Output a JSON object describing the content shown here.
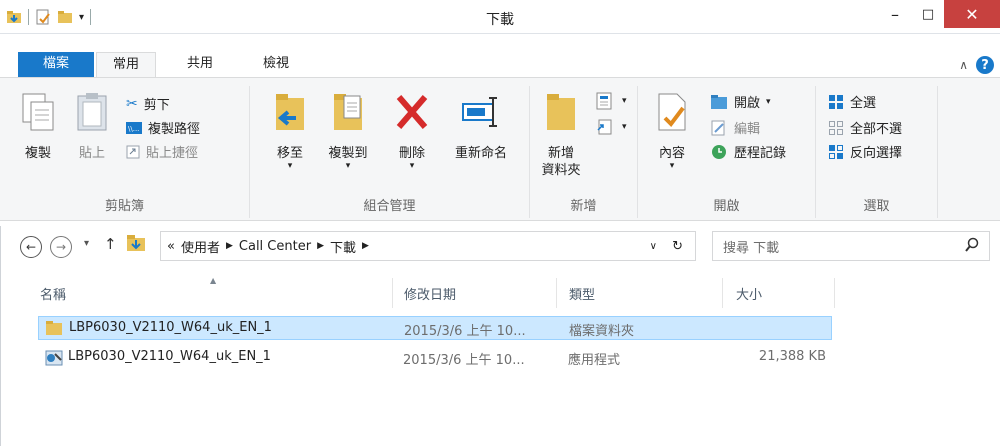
{
  "window": {
    "title": "下載",
    "minimize": "–",
    "maximize": "□",
    "close": "✕"
  },
  "ribbon_tabs": {
    "file": "檔案",
    "home": "常用",
    "share": "共用",
    "view": "檢視"
  },
  "ribbon": {
    "clipboard": {
      "label": "剪貼簿",
      "copy": "複製",
      "paste": "貼上",
      "cut": "剪下",
      "copy_path": "複製路徑",
      "paste_shortcut": "貼上捷徑"
    },
    "organize": {
      "label": "組合管理",
      "move_to": "移至",
      "copy_to": "複製到",
      "delete": "刪除",
      "rename": "重新命名"
    },
    "new": {
      "label": "新增",
      "new_folder_line1": "新增",
      "new_folder_line2": "資料夾"
    },
    "open": {
      "label": "開啟",
      "properties": "內容",
      "open": "開啟",
      "edit": "編輯",
      "history": "歷程記錄"
    },
    "select": {
      "label": "選取",
      "select_all": "全選",
      "select_none": "全部不選",
      "invert": "反向選擇"
    }
  },
  "address": {
    "crumb_overflow": "«",
    "crumbs": [
      "使用者",
      "Call Center",
      "下載"
    ],
    "search_placeholder": "搜尋 下載"
  },
  "columns": {
    "name": "名稱",
    "date": "修改日期",
    "type": "類型",
    "size": "大小"
  },
  "files": [
    {
      "name": "LBP6030_V2110_W64_uk_EN_1",
      "date": "2015/3/6 上午 10...",
      "type": "檔案資料夾",
      "size": "",
      "icon": "folder-icon",
      "selected": true
    },
    {
      "name": "LBP6030_V2110_W64_uk_EN_1",
      "date": "2015/3/6 上午 10...",
      "type": "應用程式",
      "size": "21,388 KB",
      "icon": "application-icon",
      "selected": false
    }
  ],
  "colors": {
    "accent": "#1979ca",
    "close": "#c7413f",
    "selection": "#cce8ff"
  }
}
